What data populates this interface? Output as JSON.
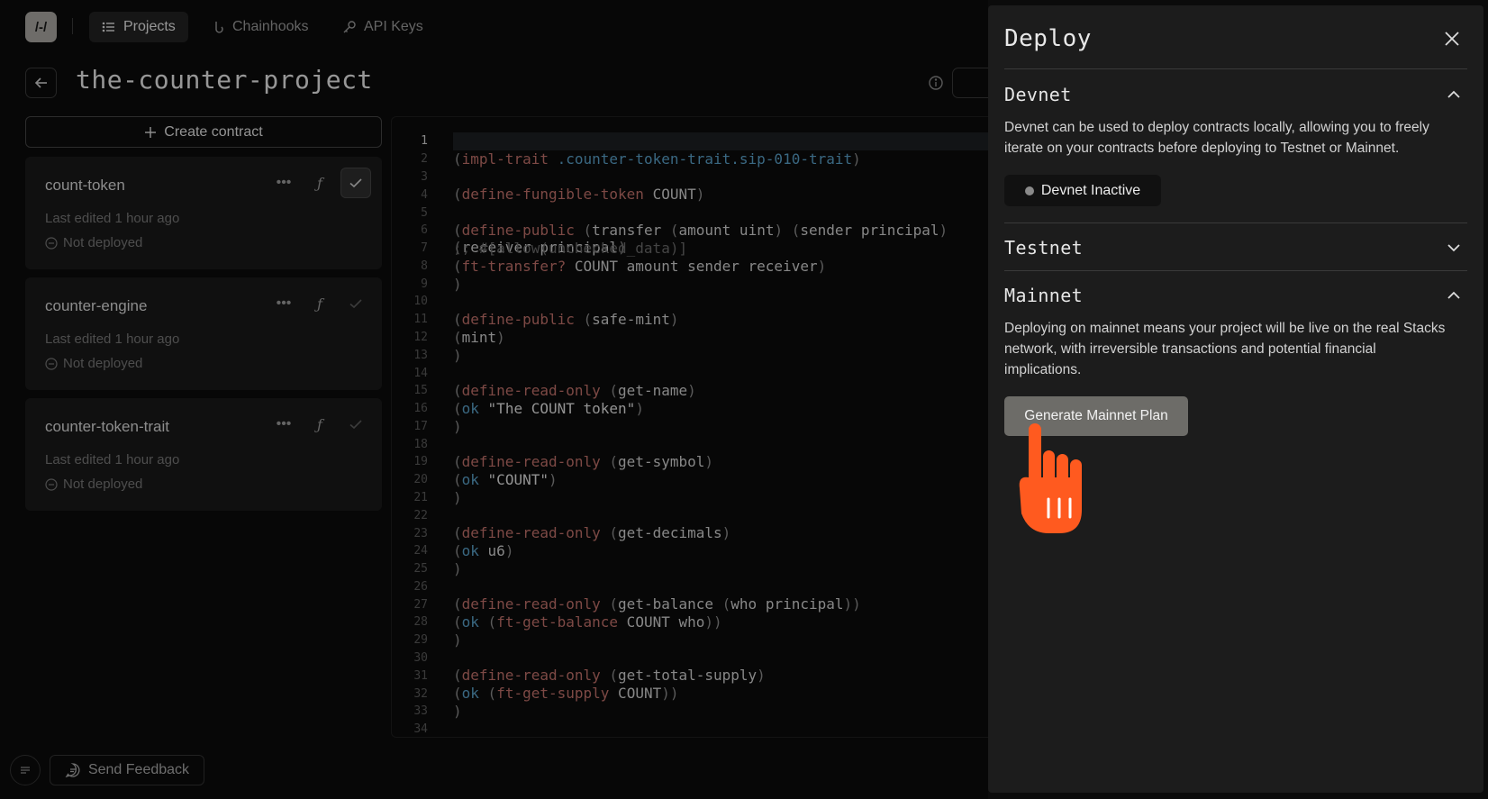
{
  "nav": {
    "logo": "/-/",
    "items": [
      {
        "label": "Projects",
        "icon": "list-icon",
        "active": true
      },
      {
        "label": "Chainhooks",
        "icon": "hook-icon",
        "active": false
      },
      {
        "label": "API Keys",
        "icon": "key-icon",
        "active": false
      }
    ]
  },
  "project": {
    "title": "the-counter-project"
  },
  "sidebar": {
    "create_label": "Create contract",
    "contracts": [
      {
        "name": "count-token",
        "edited": "Last edited 1 hour ago",
        "status": "Not deployed"
      },
      {
        "name": "counter-engine",
        "edited": "Last edited 1 hour ago",
        "status": "Not deployed"
      },
      {
        "name": "counter-token-trait",
        "edited": "Last edited 1 hour ago",
        "status": "Not deployed"
      }
    ]
  },
  "editor": {
    "line_numbers": [
      "1",
      "2",
      "3",
      "4",
      "5",
      "6",
      "7",
      "8",
      "9",
      "10",
      "11",
      "12",
      "13",
      "14",
      "15",
      "16",
      "17",
      "18",
      "19",
      "20",
      "21",
      "22",
      "23",
      "24",
      "25",
      "26",
      "27",
      "28",
      "29",
      "30",
      "31",
      "32",
      "33",
      "34"
    ]
  },
  "footer": {
    "feedback_label": "Send Feedback"
  },
  "deploy": {
    "title": "Deploy",
    "devnet": {
      "title": "Devnet",
      "description": "Devnet can be used to deploy contracts locally, allowing you to freely iterate on your contracts before deploying to Testnet or Mainnet.",
      "button": "Devnet Inactive"
    },
    "testnet": {
      "title": "Testnet"
    },
    "mainnet": {
      "title": "Mainnet",
      "description": "Deploying on mainnet means your project will be live on the real Stacks network, with irreversible transactions and potential financial implications.",
      "button": "Generate Mainnet Plan"
    }
  },
  "colors": {
    "accent_hand": "#ff5a1f",
    "panel_bg": "#1c1c1c",
    "keyword": "#c0716a",
    "symbol": "#5aa0c8"
  }
}
